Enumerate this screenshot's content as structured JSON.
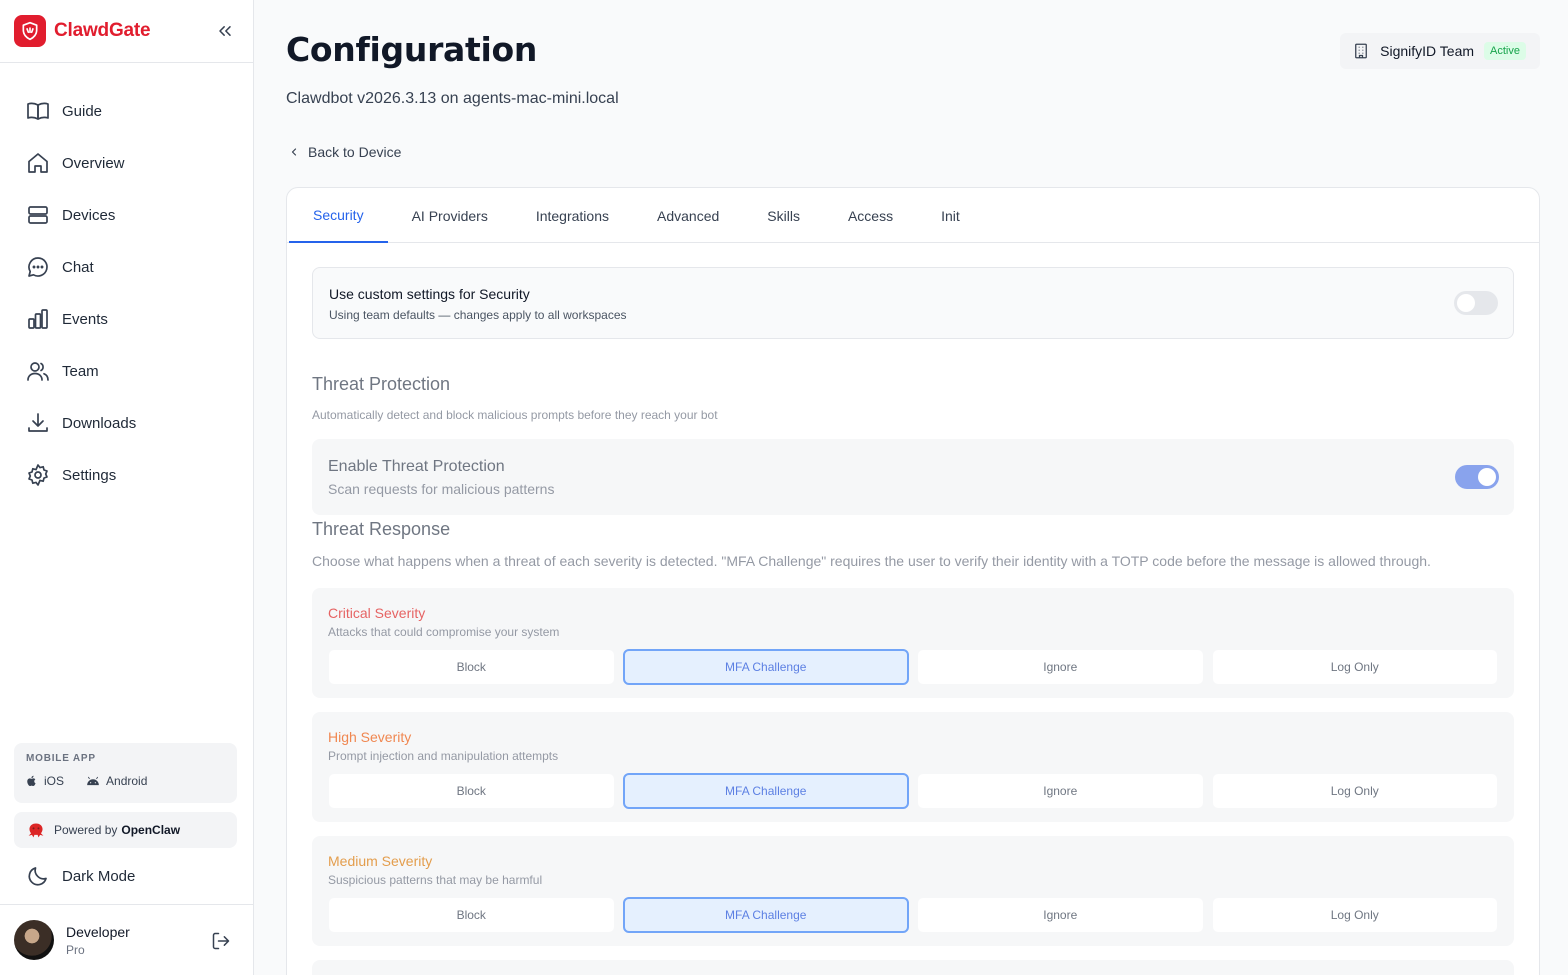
{
  "app": {
    "name": "ClawdGate"
  },
  "sidebar": {
    "items": [
      {
        "label": "Guide",
        "icon": "book-icon"
      },
      {
        "label": "Overview",
        "icon": "home-icon"
      },
      {
        "label": "Devices",
        "icon": "server-icon"
      },
      {
        "label": "Chat",
        "icon": "chat-icon"
      },
      {
        "label": "Events",
        "icon": "bar-chart-icon"
      },
      {
        "label": "Team",
        "icon": "users-icon"
      },
      {
        "label": "Downloads",
        "icon": "download-icon"
      },
      {
        "label": "Settings",
        "icon": "gear-icon"
      }
    ],
    "mobile_app": {
      "title": "MOBILE APP",
      "ios": "iOS",
      "android": "Android"
    },
    "powered_by": {
      "prefix": "Powered by",
      "name": "OpenClaw"
    },
    "dark_mode": "Dark Mode",
    "user": {
      "name": "Developer",
      "plan": "Pro"
    }
  },
  "header": {
    "title": "Configuration",
    "subtitle": "Clawdbot v2026.3.13 on agents-mac-mini.local",
    "team_name": "SignifyID Team",
    "team_status": "Active",
    "back_link": "Back to Device"
  },
  "tabs": [
    {
      "label": "Security",
      "active": true
    },
    {
      "label": "AI Providers",
      "active": false
    },
    {
      "label": "Integrations",
      "active": false
    },
    {
      "label": "Advanced",
      "active": false
    },
    {
      "label": "Skills",
      "active": false
    },
    {
      "label": "Access",
      "active": false
    },
    {
      "label": "Init",
      "active": false
    }
  ],
  "custom_settings": {
    "title": "Use custom settings for Security",
    "description": "Using team defaults — changes apply to all workspaces",
    "enabled": false
  },
  "threat_protection": {
    "title": "Threat Protection",
    "description": "Automatically detect and block malicious prompts before they reach your bot",
    "enable_title": "Enable Threat Protection",
    "enable_description": "Scan requests for malicious patterns",
    "enabled": true
  },
  "threat_response": {
    "title": "Threat Response",
    "description": "Choose what happens when a threat of each severity is detected. \"MFA Challenge\" requires the user to verify their identity with a TOTP code before the message is allowed through.",
    "options": [
      "Block",
      "MFA Challenge",
      "Ignore",
      "Log Only"
    ],
    "severities": [
      {
        "title": "Critical Severity",
        "description": "Attacks that could compromise your system",
        "color": "#dc2626",
        "selected": "MFA Challenge"
      },
      {
        "title": "High Severity",
        "description": "Prompt injection and manipulation attempts",
        "color": "#ea580c",
        "selected": "MFA Challenge"
      },
      {
        "title": "Medium Severity",
        "description": "Suspicious patterns that may be harmful",
        "color": "#d97706",
        "selected": "MFA Challenge"
      }
    ]
  },
  "colors": {
    "brand": "#e11d2e",
    "accent": "#2563eb",
    "toggle_on": "#5b7fe6",
    "active_badge": "#16a34a"
  }
}
